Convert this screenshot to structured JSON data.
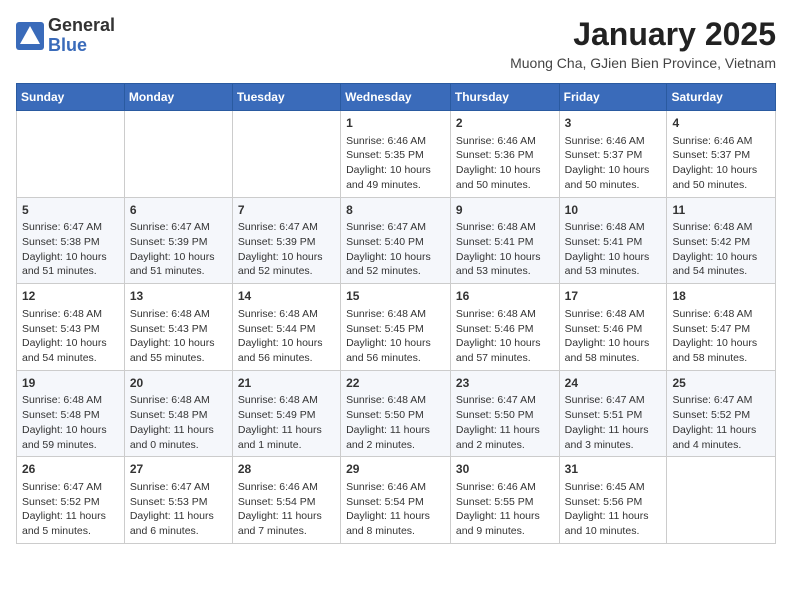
{
  "header": {
    "logo_line1": "General",
    "logo_line2": "Blue",
    "month_title": "January 2025",
    "subtitle": "Muong Cha, GJien Bien Province, Vietnam"
  },
  "columns": [
    "Sunday",
    "Monday",
    "Tuesday",
    "Wednesday",
    "Thursday",
    "Friday",
    "Saturday"
  ],
  "weeks": [
    [
      {
        "day": "",
        "info": ""
      },
      {
        "day": "",
        "info": ""
      },
      {
        "day": "",
        "info": ""
      },
      {
        "day": "1",
        "info": "Sunrise: 6:46 AM\nSunset: 5:35 PM\nDaylight: 10 hours\nand 49 minutes."
      },
      {
        "day": "2",
        "info": "Sunrise: 6:46 AM\nSunset: 5:36 PM\nDaylight: 10 hours\nand 50 minutes."
      },
      {
        "day": "3",
        "info": "Sunrise: 6:46 AM\nSunset: 5:37 PM\nDaylight: 10 hours\nand 50 minutes."
      },
      {
        "day": "4",
        "info": "Sunrise: 6:46 AM\nSunset: 5:37 PM\nDaylight: 10 hours\nand 50 minutes."
      }
    ],
    [
      {
        "day": "5",
        "info": "Sunrise: 6:47 AM\nSunset: 5:38 PM\nDaylight: 10 hours\nand 51 minutes."
      },
      {
        "day": "6",
        "info": "Sunrise: 6:47 AM\nSunset: 5:39 PM\nDaylight: 10 hours\nand 51 minutes."
      },
      {
        "day": "7",
        "info": "Sunrise: 6:47 AM\nSunset: 5:39 PM\nDaylight: 10 hours\nand 52 minutes."
      },
      {
        "day": "8",
        "info": "Sunrise: 6:47 AM\nSunset: 5:40 PM\nDaylight: 10 hours\nand 52 minutes."
      },
      {
        "day": "9",
        "info": "Sunrise: 6:48 AM\nSunset: 5:41 PM\nDaylight: 10 hours\nand 53 minutes."
      },
      {
        "day": "10",
        "info": "Sunrise: 6:48 AM\nSunset: 5:41 PM\nDaylight: 10 hours\nand 53 minutes."
      },
      {
        "day": "11",
        "info": "Sunrise: 6:48 AM\nSunset: 5:42 PM\nDaylight: 10 hours\nand 54 minutes."
      }
    ],
    [
      {
        "day": "12",
        "info": "Sunrise: 6:48 AM\nSunset: 5:43 PM\nDaylight: 10 hours\nand 54 minutes."
      },
      {
        "day": "13",
        "info": "Sunrise: 6:48 AM\nSunset: 5:43 PM\nDaylight: 10 hours\nand 55 minutes."
      },
      {
        "day": "14",
        "info": "Sunrise: 6:48 AM\nSunset: 5:44 PM\nDaylight: 10 hours\nand 56 minutes."
      },
      {
        "day": "15",
        "info": "Sunrise: 6:48 AM\nSunset: 5:45 PM\nDaylight: 10 hours\nand 56 minutes."
      },
      {
        "day": "16",
        "info": "Sunrise: 6:48 AM\nSunset: 5:46 PM\nDaylight: 10 hours\nand 57 minutes."
      },
      {
        "day": "17",
        "info": "Sunrise: 6:48 AM\nSunset: 5:46 PM\nDaylight: 10 hours\nand 58 minutes."
      },
      {
        "day": "18",
        "info": "Sunrise: 6:48 AM\nSunset: 5:47 PM\nDaylight: 10 hours\nand 58 minutes."
      }
    ],
    [
      {
        "day": "19",
        "info": "Sunrise: 6:48 AM\nSunset: 5:48 PM\nDaylight: 10 hours\nand 59 minutes."
      },
      {
        "day": "20",
        "info": "Sunrise: 6:48 AM\nSunset: 5:48 PM\nDaylight: 11 hours\nand 0 minutes."
      },
      {
        "day": "21",
        "info": "Sunrise: 6:48 AM\nSunset: 5:49 PM\nDaylight: 11 hours\nand 1 minute."
      },
      {
        "day": "22",
        "info": "Sunrise: 6:48 AM\nSunset: 5:50 PM\nDaylight: 11 hours\nand 2 minutes."
      },
      {
        "day": "23",
        "info": "Sunrise: 6:47 AM\nSunset: 5:50 PM\nDaylight: 11 hours\nand 2 minutes."
      },
      {
        "day": "24",
        "info": "Sunrise: 6:47 AM\nSunset: 5:51 PM\nDaylight: 11 hours\nand 3 minutes."
      },
      {
        "day": "25",
        "info": "Sunrise: 6:47 AM\nSunset: 5:52 PM\nDaylight: 11 hours\nand 4 minutes."
      }
    ],
    [
      {
        "day": "26",
        "info": "Sunrise: 6:47 AM\nSunset: 5:52 PM\nDaylight: 11 hours\nand 5 minutes."
      },
      {
        "day": "27",
        "info": "Sunrise: 6:47 AM\nSunset: 5:53 PM\nDaylight: 11 hours\nand 6 minutes."
      },
      {
        "day": "28",
        "info": "Sunrise: 6:46 AM\nSunset: 5:54 PM\nDaylight: 11 hours\nand 7 minutes."
      },
      {
        "day": "29",
        "info": "Sunrise: 6:46 AM\nSunset: 5:54 PM\nDaylight: 11 hours\nand 8 minutes."
      },
      {
        "day": "30",
        "info": "Sunrise: 6:46 AM\nSunset: 5:55 PM\nDaylight: 11 hours\nand 9 minutes."
      },
      {
        "day": "31",
        "info": "Sunrise: 6:45 AM\nSunset: 5:56 PM\nDaylight: 11 hours\nand 10 minutes."
      },
      {
        "day": "",
        "info": ""
      }
    ]
  ]
}
